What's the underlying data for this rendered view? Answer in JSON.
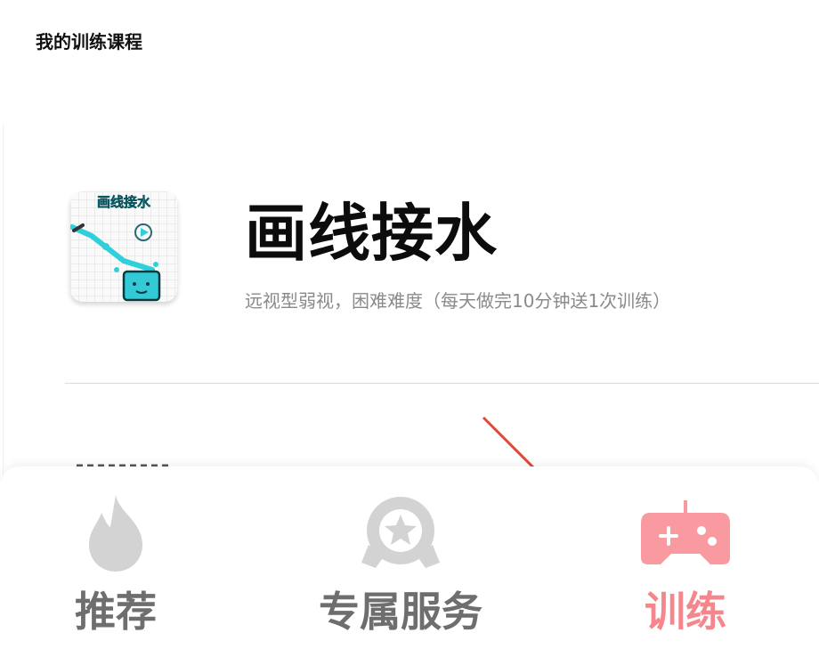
{
  "header": {
    "title": "我的训练课程"
  },
  "course": {
    "thumbnail_text": "画线接水",
    "title": "画线接水",
    "description": "远视型弱视，困难难度（每天做完10分钟送1次训练）"
  },
  "bottom_nav": {
    "tabs": [
      {
        "label": "推荐",
        "icon": "flame-icon",
        "active": false
      },
      {
        "label": "专属服务",
        "icon": "star-badge-icon",
        "active": false
      },
      {
        "label": "训练",
        "icon": "gamepad-icon",
        "active": true
      }
    ],
    "active_color": "#f4868c",
    "inactive_color": "#6e6e6e"
  },
  "colors": {
    "accent": "#f4868c",
    "annotation": "#e04a34"
  }
}
